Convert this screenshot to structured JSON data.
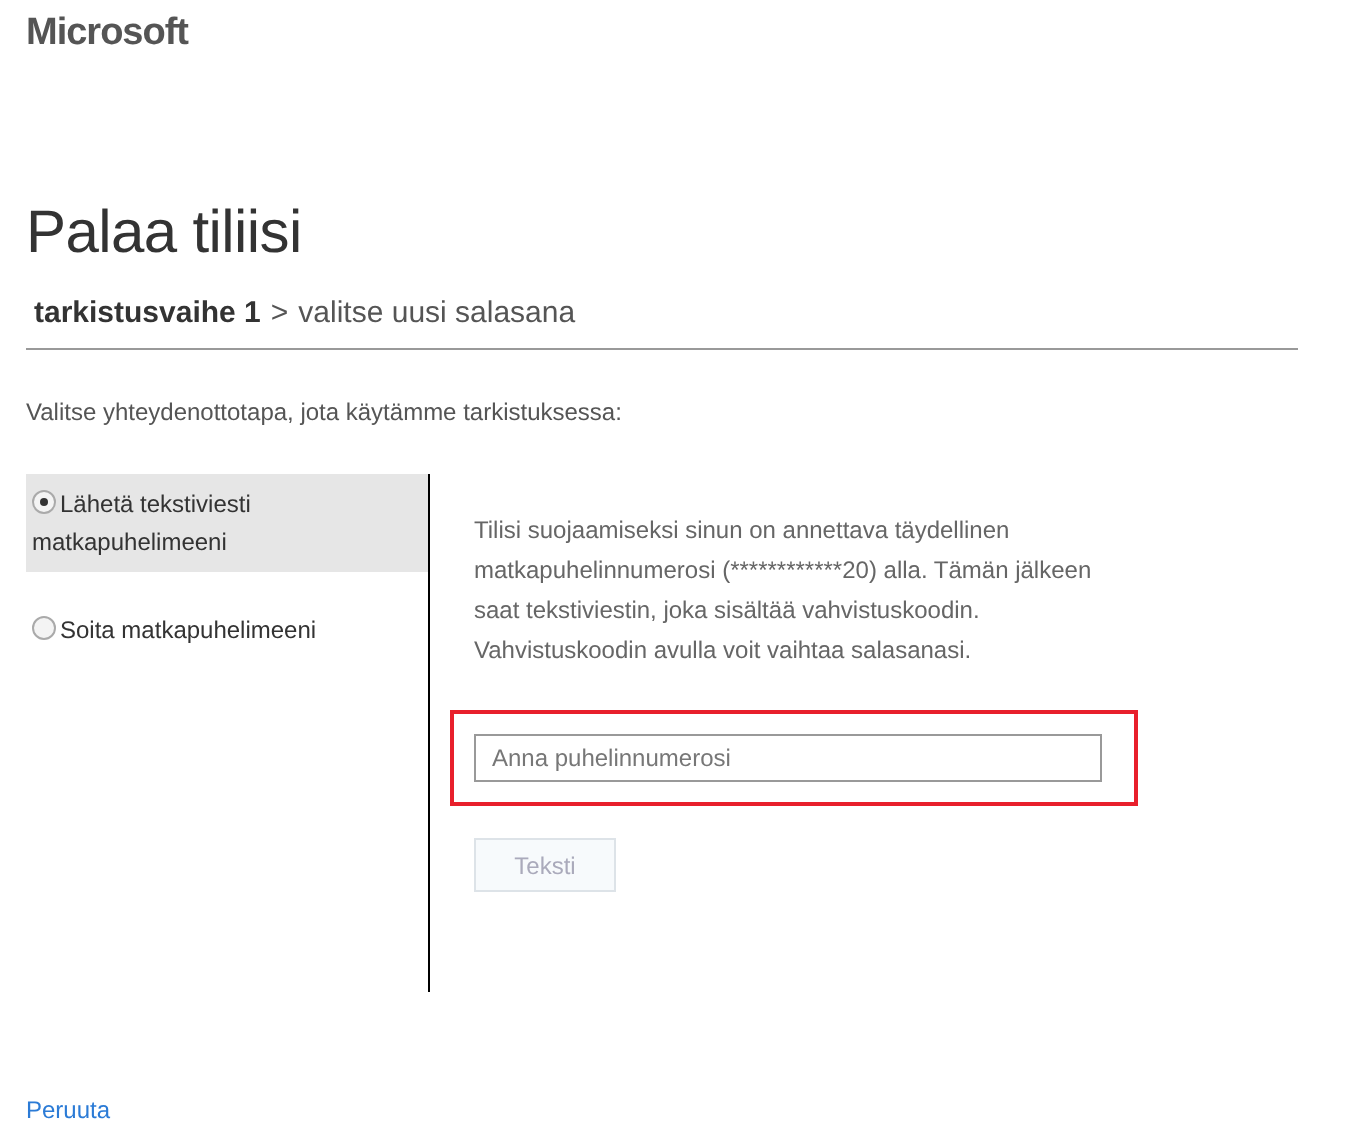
{
  "logo": "Microsoft",
  "title": "Palaa tiliisi",
  "steps": [
    {
      "label": "tarkistusvaihe 1",
      "current": true
    },
    {
      "label": "valitse uusi salasana",
      "current": false
    }
  ],
  "step_separator": ">",
  "instruction": "Valitse yhteydenottotapa, jota käytämme tarkistuksessa:",
  "options": [
    {
      "label": "Lähetä tekstiviesti matkapuhelimeeni",
      "selected": true
    },
    {
      "label": "Soita matkapuhelimeeni",
      "selected": false
    }
  ],
  "description": "Tilisi suojaamiseksi sinun on annettava täydellinen matkapuhelinnumerosi (************20) alla. Tämän jälkeen saat tekstiviestin, joka sisältää vahvistuskoodin. Vahvistuskoodin avulla voit vaihtaa salasanasi.",
  "field": {
    "placeholder": "Anna puhelinnumerosi",
    "highlighted": true
  },
  "submit": {
    "label": "Teksti",
    "disabled": true
  },
  "cancel": "Peruuta"
}
